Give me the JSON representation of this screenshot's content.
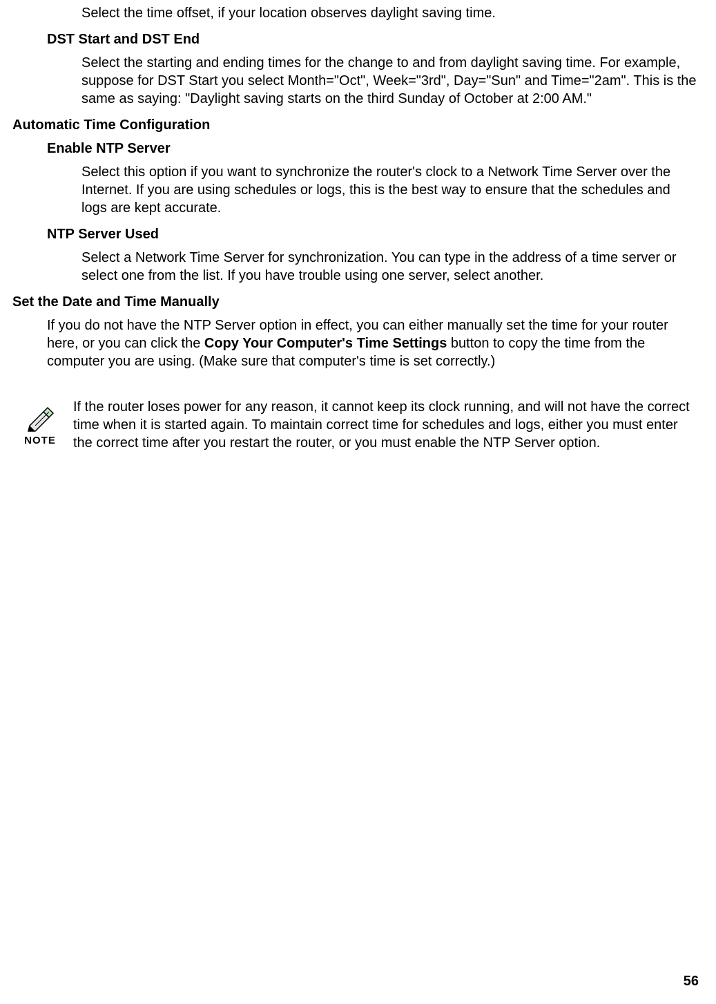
{
  "sections": {
    "dst_offset_text": "Select the time offset, if your location observes daylight saving time.",
    "dst_start_end_heading": "DST Start and DST End",
    "dst_start_end_text": "Select the starting and ending times for the change to and from daylight saving time. For example, suppose for DST Start you select Month=\"Oct\", Week=\"3rd\", Day=\"Sun\" and Time=\"2am\". This is the same as saying: \"Daylight saving starts on the third Sunday of October at 2:00 AM.\"",
    "auto_time_heading": "Automatic Time Configuration",
    "enable_ntp_heading": "Enable NTP Server",
    "enable_ntp_text": "Select this option if you want to synchronize the router's clock to a Network Time Server over the Internet. If you are using schedules or logs, this is the best way to ensure that the schedules and logs are kept accurate.",
    "ntp_used_heading": "NTP Server Used",
    "ntp_used_text": "Select a Network Time Server for synchronization. You can type in the address of a time server or select one from the list. If you have trouble using one server, select another.",
    "manual_heading": "Set the Date and Time Manually",
    "manual_text_pre": "If you do not have the NTP Server option in effect, you can either manually set the time for your router here, or you can click the ",
    "manual_bold": "Copy Your Computer's Time Settings",
    "manual_text_post": " button to copy the time from the computer you are using. (Make sure that computer's time is set correctly.)"
  },
  "note": {
    "label": "NOTE",
    "text": "If the router loses power for any reason, it cannot keep its clock running, and will not have the correct time when it is started again. To maintain correct time for schedules and logs, either you must enter the correct time after you restart the router, or you must enable the NTP Server option."
  },
  "page_number": "56"
}
